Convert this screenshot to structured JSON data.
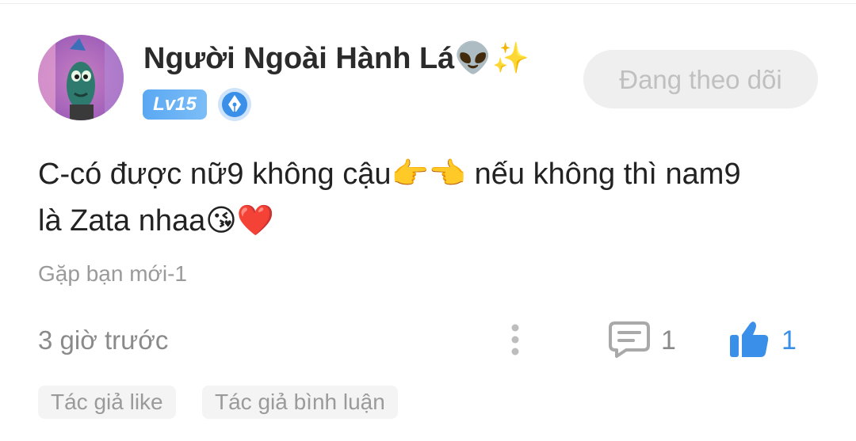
{
  "post": {
    "username": "Người Ngoài Hành Lá",
    "username_emoji": "👽✨",
    "level": "Lv15",
    "follow_label": "Đang theo dõi",
    "comment_line1": "C-có được nữ9 không cậu",
    "comment_emoji1": "👉👈",
    "comment_line1b": " nếu không thì nam9",
    "comment_line2": "là Zata nhaa",
    "comment_emoji2": "😘❤️",
    "source": "Gặp bạn mới-1",
    "time": "3 giờ trước",
    "comment_count": "1",
    "like_count": "1"
  },
  "tags": [
    "Tác giả like",
    "Tác giả bình luận"
  ],
  "icons": {
    "more": "more-vertical-icon",
    "comment": "comment-bubble-icon",
    "like": "thumbs-up-icon",
    "badge": "pen-nib-badge-icon"
  },
  "colors": {
    "accent": "#3a8fe8",
    "level_badge": "#5aa8f3",
    "muted_text": "#8a8a8a"
  }
}
